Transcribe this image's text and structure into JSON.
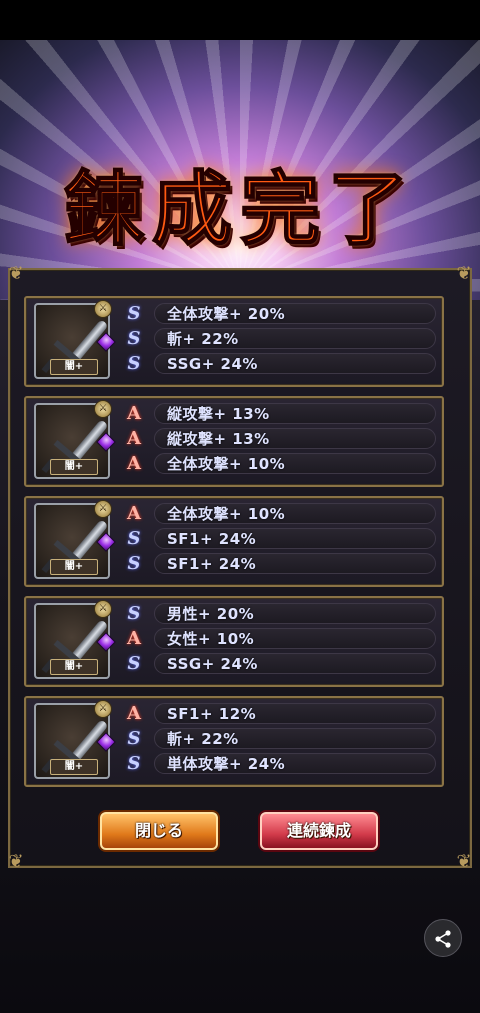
{
  "title": "鍊成完了",
  "weapon_label": "闇+",
  "cards": [
    {
      "stats": [
        {
          "type": "S",
          "text": "全体攻撃+ 20%"
        },
        {
          "type": "S",
          "text": "斬+ 22%"
        },
        {
          "type": "S",
          "text": "SSG+ 24%"
        }
      ]
    },
    {
      "stats": [
        {
          "type": "A",
          "text": "縦攻撃+ 13%"
        },
        {
          "type": "A",
          "text": "縦攻撃+ 13%"
        },
        {
          "type": "A",
          "text": "全体攻撃+ 10%"
        }
      ]
    },
    {
      "stats": [
        {
          "type": "A",
          "text": "全体攻撃+ 10%"
        },
        {
          "type": "S",
          "text": "SF1+ 24%"
        },
        {
          "type": "S",
          "text": "SF1+ 24%"
        }
      ]
    },
    {
      "stats": [
        {
          "type": "S",
          "text": "男性+ 20%"
        },
        {
          "type": "A",
          "text": "女性+ 10%"
        },
        {
          "type": "S",
          "text": "SSG+ 24%"
        }
      ]
    },
    {
      "stats": [
        {
          "type": "A",
          "text": "SF1+ 12%"
        },
        {
          "type": "S",
          "text": "斬+ 22%"
        },
        {
          "type": "S",
          "text": "単体攻撃+ 24%"
        }
      ]
    }
  ],
  "type_glyphs": {
    "S": "S",
    "A": "A"
  },
  "buttons": {
    "close": "閉じる",
    "repeat": "連続鍊成"
  },
  "share_icon": "share-icon"
}
